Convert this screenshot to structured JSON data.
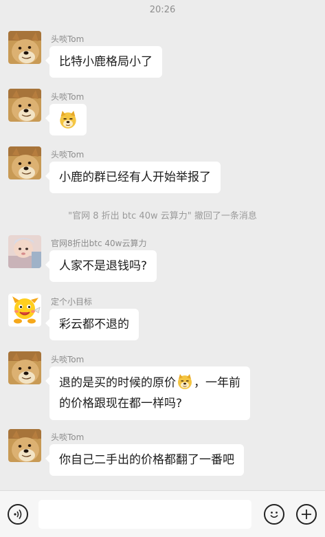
{
  "chat": {
    "timestamp": "20:26",
    "messages": [
      {
        "sender": "头啖Tom",
        "avatar": "doge-avatar-icon",
        "text": "比特小鹿格局小了"
      },
      {
        "sender": "头啖Tom",
        "avatar": "doge-avatar-icon",
        "text": "",
        "sticker": "doge-emoji-icon"
      },
      {
        "sender": "头啖Tom",
        "avatar": "doge-avatar-icon",
        "text": "小鹿的群已经有人开始举报了"
      },
      {
        "sender": "官网8折出btc 40w云算力",
        "avatar": "baby-photo-avatar",
        "text": "人家不是退钱吗?"
      },
      {
        "sender": "定个小目标",
        "avatar": "yellow-cartoon-avatar-icon",
        "text": "彩云都不退的"
      },
      {
        "sender": "头啖Tom",
        "avatar": "doge-avatar-icon",
        "text_line1_a": "退的是买的时候的原价",
        "text_line1_b": "，一年前",
        "text_line2": "的价格跟现在都一样吗?"
      },
      {
        "sender": "头啖Tom",
        "avatar": "doge-avatar-icon",
        "text": "你自己二手出的价格都翻了一番吧"
      }
    ],
    "system_notice": "\"官网 8 折出 btc 40w 云算力\" 撤回了一条消息"
  },
  "input_bar": {
    "voice_icon": "voice-wave-icon",
    "emoji_icon": "smiley-face-icon",
    "plus_icon": "plus-icon",
    "placeholder": ""
  }
}
